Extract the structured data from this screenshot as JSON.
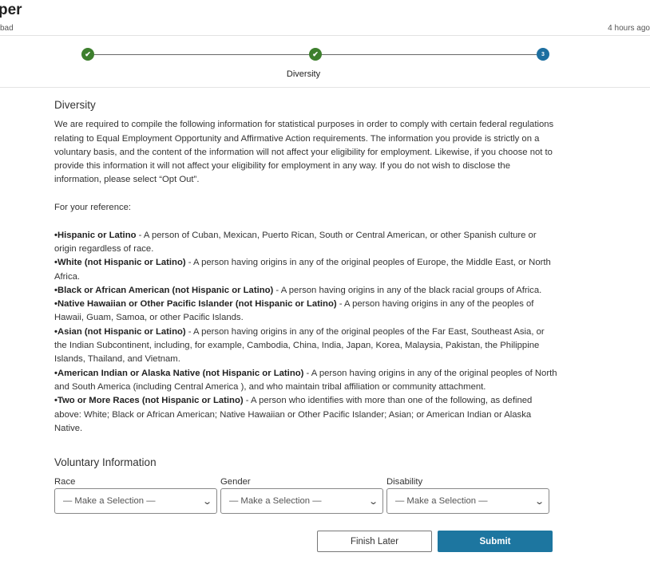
{
  "header": {
    "title": "per",
    "subtitle": "bad",
    "time": "4 hours ago"
  },
  "steps": [
    {
      "status": "complete",
      "label": ""
    },
    {
      "status": "complete",
      "label": "Diversity"
    },
    {
      "status": "current",
      "number": "3",
      "label": ""
    }
  ],
  "colors": {
    "complete": "#3d7f2d",
    "current": "#1d6fa0",
    "submit": "#1d76a0"
  },
  "diversity": {
    "heading": "Diversity",
    "intro": "We are required to compile the following information for statistical purposes in order to comply with certain federal regulations relating to Equal Employment Opportunity and Affirmative Action requirements. The information you provide is strictly on a voluntary basis, and the content of the information will not affect your eligibility for employment. Likewise, if you choose not to provide this information it will not affect your eligibility for employment in any way. If you do not wish to disclose the information, please select “Opt Out”.",
    "reference": "For your reference:",
    "definitions": [
      {
        "term": "•Hispanic or Latino",
        "text": " - A person of Cuban, Mexican, Puerto Rican, South or Central American, or other Spanish culture or origin regardless of race."
      },
      {
        "term": "•White (not Hispanic or Latino)",
        "text": " - A person having origins in any of the original peoples of Europe, the Middle East, or North Africa."
      },
      {
        "term": "•Black or African American (not Hispanic or Latino)",
        "text": " - A person having origins in any of the black racial groups of Africa."
      },
      {
        "term": "•Native Hawaiian or Other Pacific Islander (not Hispanic or Latino)",
        "text": " - A person having origins in any of the peoples of Hawaii, Guam, Samoa, or other Pacific Islands."
      },
      {
        "term": "•Asian (not Hispanic or Latino)",
        "text": " - A person having origins in any of the original peoples of the Far East, Southeast Asia, or the Indian Subcontinent, including, for example, Cambodia, China, India, Japan, Korea, Malaysia, Pakistan, the Philippine Islands, Thailand, and Vietnam."
      },
      {
        "term": "•American Indian or Alaska Native (not Hispanic or Latino)",
        "text": " - A person having origins in any of the original peoples of North and South America (including Central America ), and who maintain tribal affiliation or community attachment."
      },
      {
        "term": "•Two or More Races (not Hispanic or Latino)",
        "text": " - A person who identifies with more than one of the following, as defined above: White; Black or African American; Native Hawaiian or Other Pacific Islander; Asian; or American Indian or Alaska Native."
      }
    ]
  },
  "voluntary": {
    "heading": "Voluntary Information",
    "fields": [
      {
        "label": "Race",
        "value": "— Make a Selection —"
      },
      {
        "label": "Gender",
        "value": "— Make a Selection —"
      },
      {
        "label": "Disability",
        "value": "— Make a Selection —"
      }
    ]
  },
  "buttons": {
    "finish_later": "Finish Later",
    "submit": "Submit"
  }
}
